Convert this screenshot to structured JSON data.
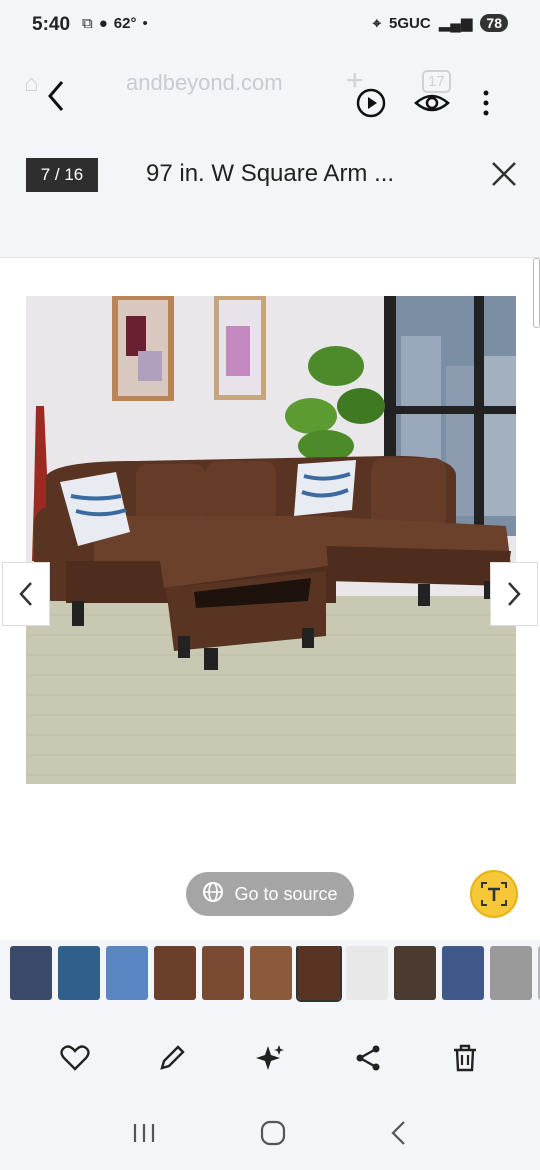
{
  "status_bar": {
    "time": "5:40",
    "temperature": "62°",
    "network": "5GUC",
    "battery": "78"
  },
  "browser": {
    "url_faded": "andbeyond.com",
    "tab_count": "17"
  },
  "viewer": {
    "counter": "7 / 16",
    "title": "97 in. W Square Arm ...",
    "go_to_source": "Go to source"
  },
  "colors": {
    "accent_yellow": "#f6c737",
    "sofa_brown": "#5a3422",
    "button_gray": "#a5a5a5"
  },
  "thumbnails": [
    {
      "name": "thumb-1",
      "color": "#3b4a6a"
    },
    {
      "name": "thumb-2",
      "color": "#2f5f8a"
    },
    {
      "name": "thumb-3",
      "color": "#5b86c4"
    },
    {
      "name": "thumb-4",
      "color": "#6b3f2a"
    },
    {
      "name": "thumb-5",
      "color": "#7a4a33"
    },
    {
      "name": "thumb-6",
      "color": "#8a5a3a"
    },
    {
      "name": "thumb-7",
      "color": "#5a3422"
    },
    {
      "name": "thumb-8",
      "color": "#e8e8e8"
    },
    {
      "name": "thumb-9",
      "color": "#4a3a30"
    },
    {
      "name": "thumb-10",
      "color": "#3f5a8a"
    },
    {
      "name": "thumb-11",
      "color": "#9a9a9a"
    },
    {
      "name": "thumb-12",
      "color": "#b5b5b5"
    }
  ],
  "toolbar": {
    "icons": [
      "heart-icon",
      "edit-icon",
      "sparkle-icon",
      "share-icon",
      "trash-icon"
    ]
  }
}
